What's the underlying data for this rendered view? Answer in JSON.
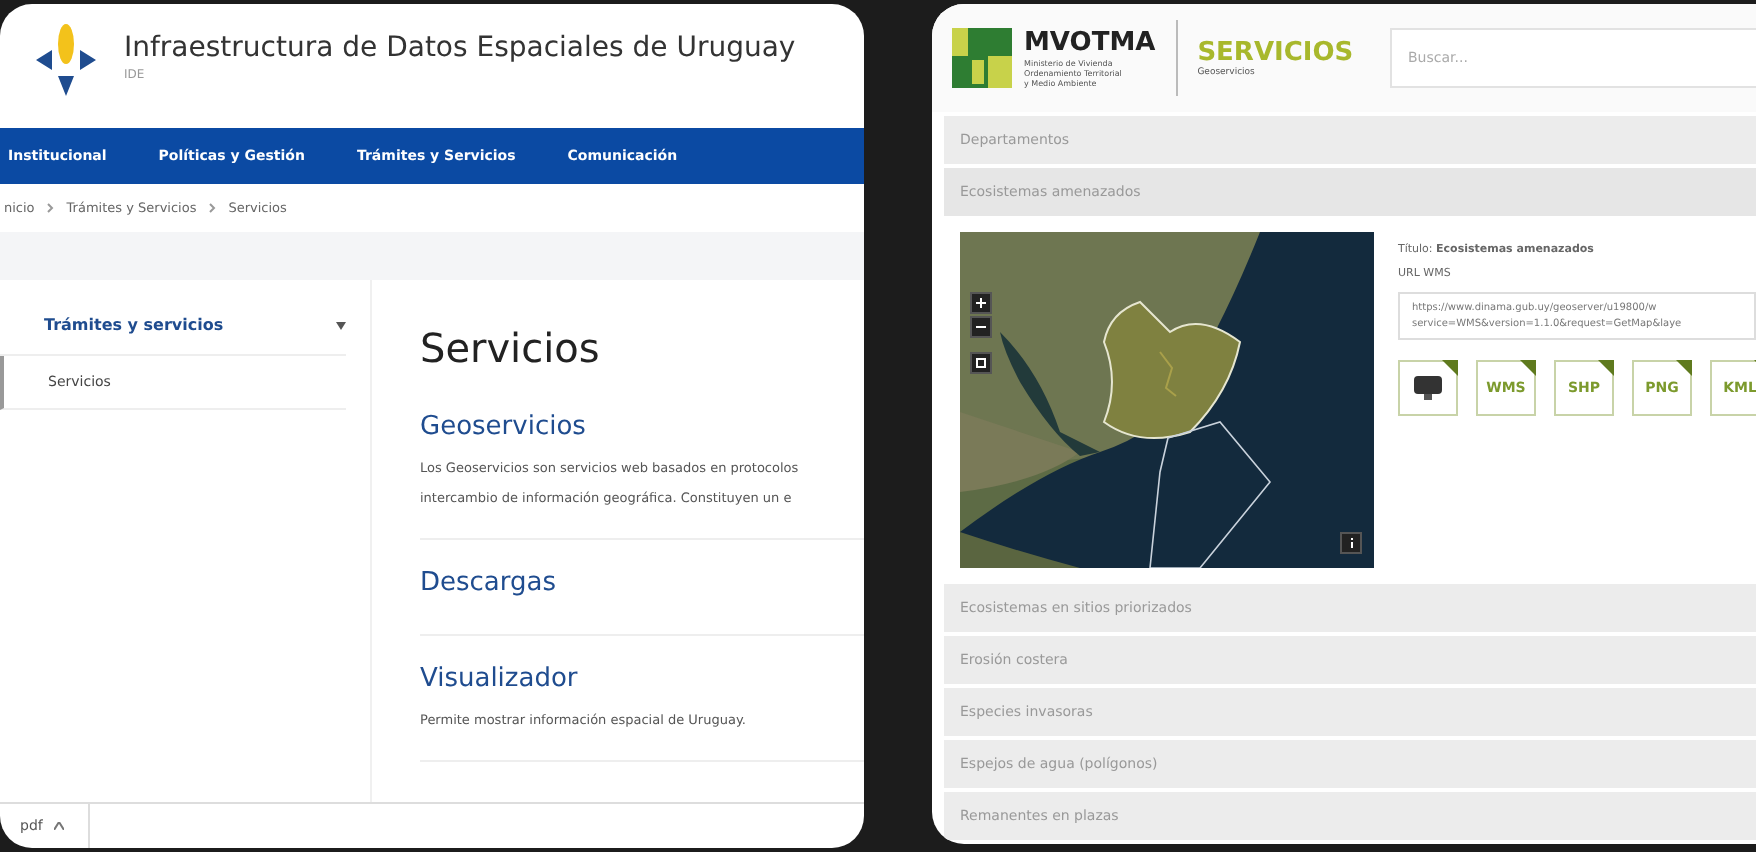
{
  "left_page": {
    "site_title": "Infraestructura de Datos Espaciales de Uruguay",
    "site_subtitle": "IDE",
    "nav": [
      "Institucional",
      "Políticas y Gestión",
      "Trámites y Servicios",
      "Comunicación"
    ],
    "breadcrumb": [
      "nicio",
      "Trámites y Servicios",
      "Servicios"
    ],
    "sidebar": {
      "title": "Trámites y servicios",
      "items": [
        {
          "label": "Servicios",
          "selected": true
        }
      ]
    },
    "heading": "Servicios",
    "sections": [
      {
        "title": "Geoservicios",
        "description": [
          "Los Geoservicios son servicios web basados en protocolos",
          "intercambio de información geográfica. Constituyen un e"
        ]
      },
      {
        "title": "Descargas"
      },
      {
        "title": "Visualizador",
        "description": [
          "Permite mostrar información espacial de Uruguay."
        ]
      }
    ],
    "footer_tab": "pdf"
  },
  "right_page": {
    "brand": {
      "name": "MVOTMA",
      "ministry": [
        "Ministerio de Vivienda",
        "Ordenamiento Territorial",
        "y Medio Ambiente"
      ],
      "section": "SERVICIOS",
      "subsection": "Geoservicios"
    },
    "search": {
      "placeholder": "Buscar..."
    },
    "layers": [
      {
        "label": "Departamentos"
      },
      {
        "label": "Ecosistemas amenazados",
        "detail": {
          "title_label": "Título:",
          "title_value": "Ecosistemas amenazados",
          "url_label": "URL WMS",
          "url_lines": [
            "https://www.dinama.gub.uy/geoserver/u19800/w",
            "service=WMS&version=1.1.0&request=GetMap&laye"
          ],
          "formats": [
            {
              "kind": "screen"
            },
            {
              "kind": "file",
              "label": "WMS"
            },
            {
              "kind": "file",
              "label": "SHP"
            },
            {
              "kind": "file",
              "label": "PNG"
            },
            {
              "kind": "file",
              "label": "KML"
            }
          ]
        }
      },
      {
        "label": "Ecosistemas en sitios priorizados"
      },
      {
        "label": "Erosión costera"
      },
      {
        "label": "Especies invasoras"
      },
      {
        "label": "Espejos de agua (polígonos)"
      },
      {
        "label": "Remanentes en plazas"
      }
    ]
  }
}
